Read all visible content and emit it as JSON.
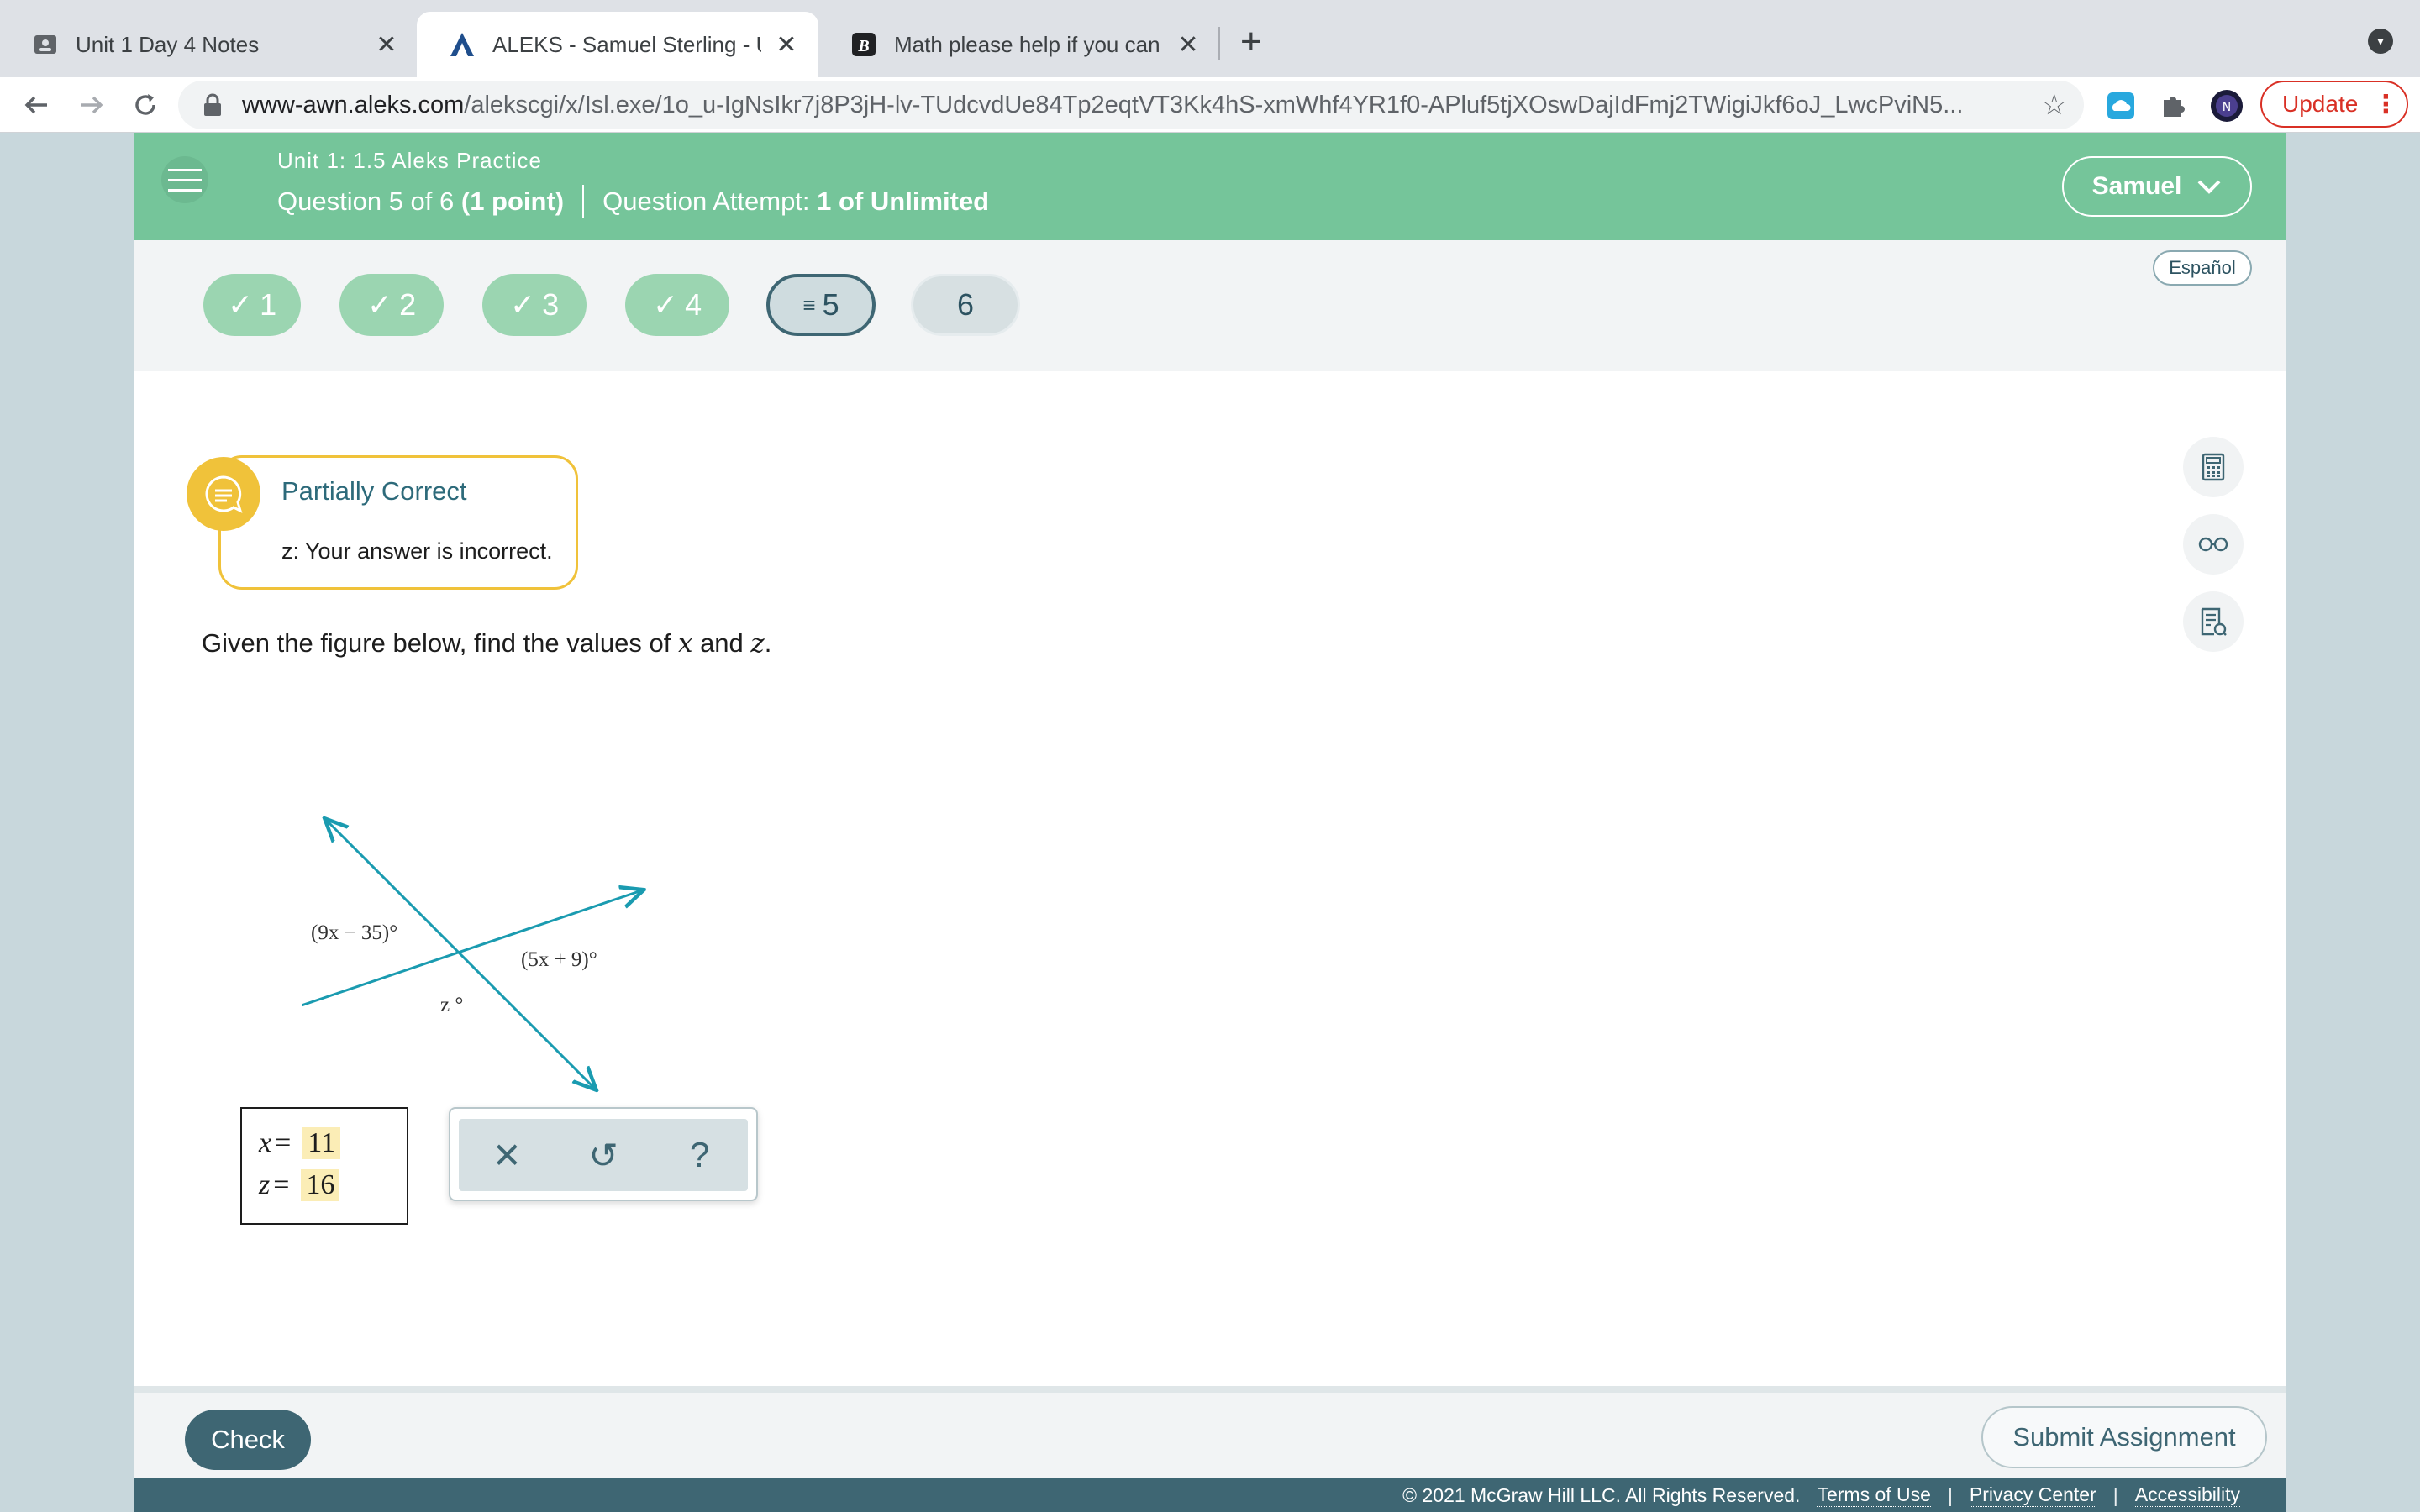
{
  "browser": {
    "tabs": [
      {
        "title": "Unit 1 Day 4 Notes",
        "active": false
      },
      {
        "title": "ALEKS - Samuel Sterling - Unit",
        "active": true
      },
      {
        "title": "Math please help if you can (I c",
        "active": false
      }
    ],
    "close_glyph": "✕",
    "new_tab_glyph": "+",
    "url_host": "www-awn.aleks.com",
    "url_path": "/alekscgi/x/Isl.exe/1o_u-IgNsIkr7j8P3jH-lv-TUdcvdUe84Tp2eqtVT3Kk4hS-xmWhf4YR1f0-APluf5tjXOswDajIdFmj2TWigiJkf6oJ_LwcPviN5...",
    "update_label": "Update"
  },
  "header": {
    "title": "Unit 1: 1.5 Aleks Practice",
    "question_prefix": "Question 5 of 6",
    "question_points": "(1 point)",
    "attempt_prefix": "Question Attempt:",
    "attempt_value": "1 of Unlimited",
    "user_name": "Samuel"
  },
  "question_nav": [
    {
      "label": "1",
      "status": "done"
    },
    {
      "label": "2",
      "status": "done"
    },
    {
      "label": "3",
      "status": "done"
    },
    {
      "label": "4",
      "status": "done"
    },
    {
      "label": "5",
      "status": "current"
    },
    {
      "label": "6",
      "status": "todo"
    }
  ],
  "language_label": "Español",
  "feedback": {
    "title": "Partially Correct",
    "message": "z: Your answer is incorrect."
  },
  "question": {
    "prefix": "Given the figure below, find the values of ",
    "var1": "x",
    "mid": " and ",
    "var2": "z",
    "suffix": "."
  },
  "figure": {
    "label_top_left": "(9x − 35)°",
    "label_right": "(5x + 9)°",
    "label_bottom": "z °"
  },
  "answers": [
    {
      "var": "x",
      "eq": "=",
      "value": "11"
    },
    {
      "var": "z",
      "eq": "=",
      "value": "16"
    }
  ],
  "keypad": {
    "clear_glyph": "✕",
    "undo_glyph": "↺",
    "help_glyph": "?"
  },
  "footer": {
    "check_label": "Check",
    "submit_label": "Submit Assignment"
  },
  "legal": {
    "copyright": "© 2021 McGraw Hill LLC. All Rights Reserved.",
    "terms": "Terms of Use",
    "privacy": "Privacy Center",
    "accessibility": "Accessibility",
    "separator": "|"
  },
  "colors": {
    "header_green": "#75c59a",
    "done_pill": "#9bd5b1",
    "dark_teal": "#3e6673",
    "feedback_yellow": "#f0c23a",
    "figure_line": "#1a9bb0",
    "answer_highlight": "#fbedb6"
  }
}
